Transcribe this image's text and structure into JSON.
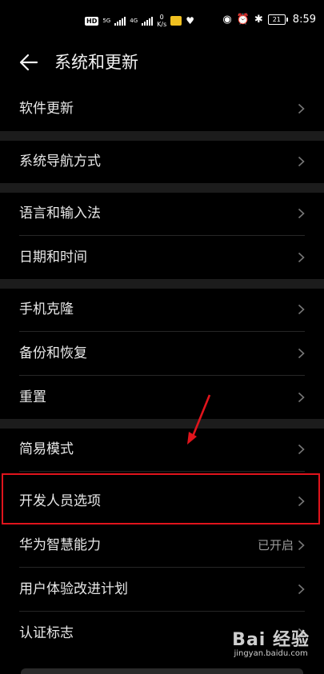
{
  "status_bar": {
    "hd": "HD",
    "net1": "5G",
    "net2": "4G",
    "speed_value": "0",
    "speed_unit": "K/s",
    "battery": "21",
    "time": "8:59",
    "icons": [
      "signal-icon",
      "eye-icon",
      "alarm-icon",
      "bluetooth-icon",
      "battery-icon"
    ]
  },
  "header": {
    "title": "系统和更新",
    "back_icon": "back-arrow-icon"
  },
  "groups": [
    {
      "items": [
        {
          "label": "软件更新"
        }
      ]
    },
    {
      "items": [
        {
          "label": "系统导航方式"
        }
      ]
    },
    {
      "items": [
        {
          "label": "语言和输入法"
        },
        {
          "label": "日期和时间"
        }
      ]
    },
    {
      "items": [
        {
          "label": "手机克隆"
        },
        {
          "label": "备份和恢复"
        },
        {
          "label": "重置"
        }
      ]
    },
    {
      "items": [
        {
          "label": "简易模式"
        },
        {
          "label": "开发人员选项"
        },
        {
          "label": "华为智慧能力",
          "value": "已开启"
        },
        {
          "label": "用户体验改进计划"
        },
        {
          "label": "认证标志"
        }
      ]
    }
  ],
  "annotation": {
    "highlight_color": "#e0141c"
  },
  "watermark": {
    "logo": "Bai 经验",
    "url": "jingyan.baidu.com"
  },
  "colors": {
    "background": "#000000",
    "divider": "#1c1c1c",
    "text": "#e8e8e8",
    "secondary": "#9a9a9a"
  }
}
